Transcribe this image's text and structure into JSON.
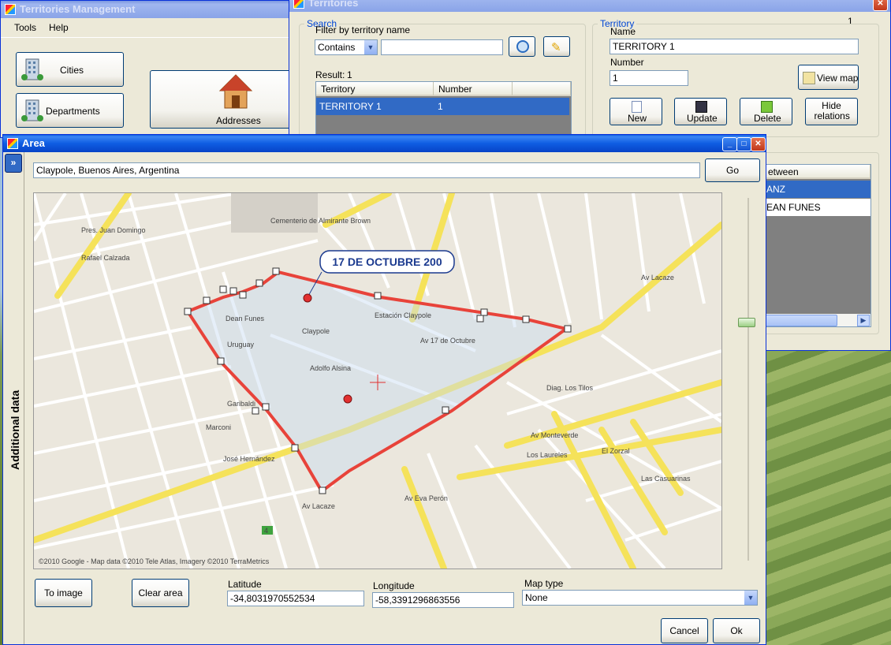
{
  "main_window": {
    "title": "Territories Management",
    "menu": [
      "Tools",
      "Help"
    ],
    "buttons": {
      "cities": "Cities",
      "departments": "Departments",
      "addresses": "Addresses"
    }
  },
  "territories_window": {
    "title": "Territories",
    "corner_value": "1",
    "search": {
      "group_label": "Search",
      "filter_label": "Filter by territory name",
      "filter_mode": "Contains",
      "filter_text": "",
      "result_label": "Result:",
      "result_count": "1",
      "columns": [
        "Territory",
        "Number"
      ],
      "rows": [
        {
          "territory": "TERRITORY 1",
          "number": "1"
        }
      ]
    },
    "territory": {
      "group_label": "Territory",
      "name_label": "Name",
      "name_value": "TERRITORY 1",
      "number_label": "Number",
      "number_value": "1",
      "view_map": "View map",
      "new": "New",
      "update": "Update",
      "delete": "Delete",
      "hide_relations": "Hide relations"
    },
    "relations": {
      "column": "etween",
      "rows": [
        "ANZ",
        "EAN FUNES"
      ]
    }
  },
  "area_window": {
    "title": "Area",
    "side_panel_label": "Additional data",
    "expand_glyph": "»",
    "search_value": "Claypole, Buenos Aires, Argentina",
    "go": "Go",
    "map": {
      "callout": "17 DE OCTUBRE 200",
      "attribution": "©2010 Google - Map data ©2010 Tele Atlas, Imagery ©2010 TerraMetrics",
      "place_labels": [
        "Cementerio de Almirante Brown",
        "Claypole",
        "Estación Claypole",
        "Av 17 de Octubre",
        "Dean Funes",
        "Adolfo Alsina",
        "Av Lacaze",
        "Av Monteverde",
        "Los Laureles",
        "El Zorzal",
        "Las Casuarinas",
        "Av Eva Perón",
        "Diag. Los Tilos",
        "Pres. Juan Domingo",
        "Rafael Calzada",
        "Uruguay",
        "Garibaldi",
        "Marconi",
        "José Hernández",
        "Av Lacaze",
        "4"
      ]
    },
    "to_image": "To image",
    "clear_area": "Clear area",
    "latitude_label": "Latitude",
    "latitude_value": "-34,8031970552534",
    "longitude_label": "Longitude",
    "longitude_value": "-58,3391296863556",
    "map_type_label": "Map type",
    "map_type_value": "None",
    "cancel": "Cancel",
    "ok": "Ok"
  },
  "colors": {
    "titlebar": "#0a5bdf",
    "selection": "#316ac5",
    "polygon": "#e8433a",
    "road": "#f5e25a"
  }
}
